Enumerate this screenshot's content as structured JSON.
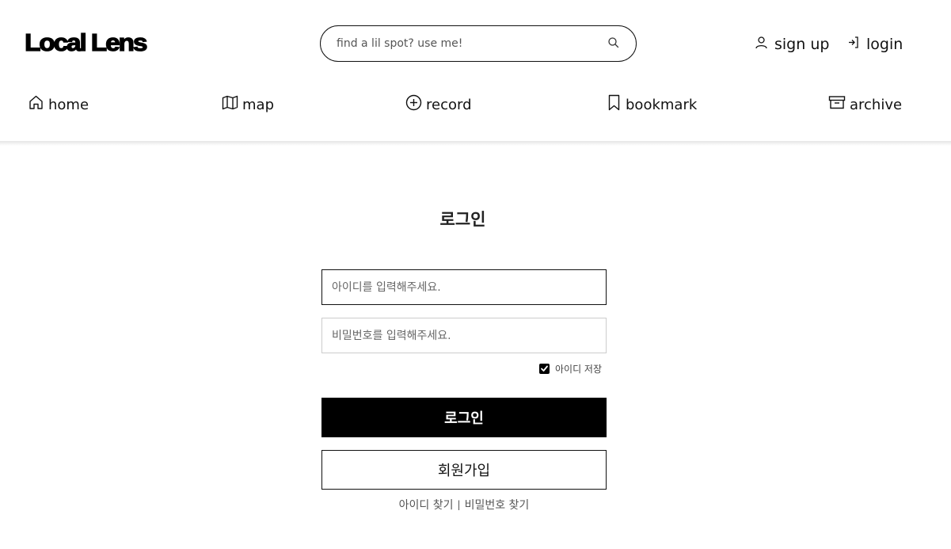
{
  "header": {
    "logo": "Local Lens",
    "search": {
      "placeholder": "find a lil spot? use me!",
      "icon": "search-icon"
    },
    "auth": [
      {
        "label": "sign up",
        "icon": "user-icon"
      },
      {
        "label": "login",
        "icon": "login-arrow-icon"
      }
    ]
  },
  "nav": [
    {
      "label": "home",
      "icon": "home-icon"
    },
    {
      "label": "map",
      "icon": "map-icon"
    },
    {
      "label": "record",
      "icon": "plus-circle-icon"
    },
    {
      "label": "bookmark",
      "icon": "bookmark-icon"
    },
    {
      "label": "archive",
      "icon": "archive-icon"
    }
  ],
  "login_form": {
    "title": "로그인",
    "id_placeholder": "아이디를 입력해주세요.",
    "password_placeholder": "비밀번호를 입력해주세요.",
    "remember_label": "아이디 저장",
    "remember_checked": true,
    "submit_label": "로그인",
    "signup_label": "회원가입",
    "find_id_label": "아이디 찾기",
    "separator": "|",
    "find_password_label": "비밀번호 찾기"
  },
  "colors": {
    "primary": "#000000",
    "background": "#ffffff",
    "text": "#111111"
  }
}
